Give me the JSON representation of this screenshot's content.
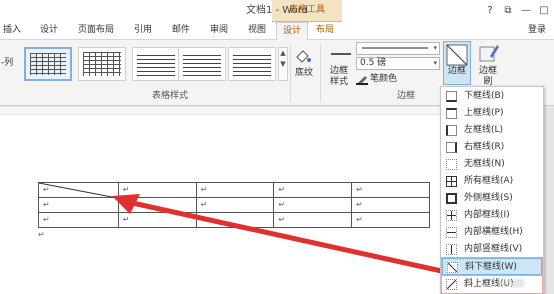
{
  "window": {
    "title": "文档1 - Word",
    "context_group": "表格工具",
    "help": "?",
    "restore": "⧉",
    "minimize": "—",
    "maximize": "□",
    "signin": "登录"
  },
  "tabs": [
    "插入",
    "设计",
    "页面布局",
    "引用",
    "邮件",
    "审阅",
    "视图",
    "设计",
    "布局"
  ],
  "ribbon": {
    "left_edge_label": "-列",
    "shading_label": "底纹",
    "border_style_label": "边框样式",
    "line_weight": "0.5 磅",
    "pen_color_label": "笔颜色",
    "borders_label": "边框",
    "border_painter_label": "边框刷",
    "group_table_styles": "表格样式",
    "group_borders": "边框"
  },
  "table": {
    "cell_mark": "↵",
    "rows": 3,
    "cols": 5
  },
  "border_menu": {
    "items": [
      "下框线(B)",
      "上框线(P)",
      "左框线(L)",
      "右框线(R)",
      "无框线(N)",
      "所有框线(A)",
      "外侧框线(S)",
      "内部框线(I)",
      "内部横框线(H)",
      "内部竖框线(V)",
      "斜下框线(W)",
      "斜上框线(U)"
    ],
    "highlighted": "斜下框线(W)"
  },
  "watermark": "小站图"
}
